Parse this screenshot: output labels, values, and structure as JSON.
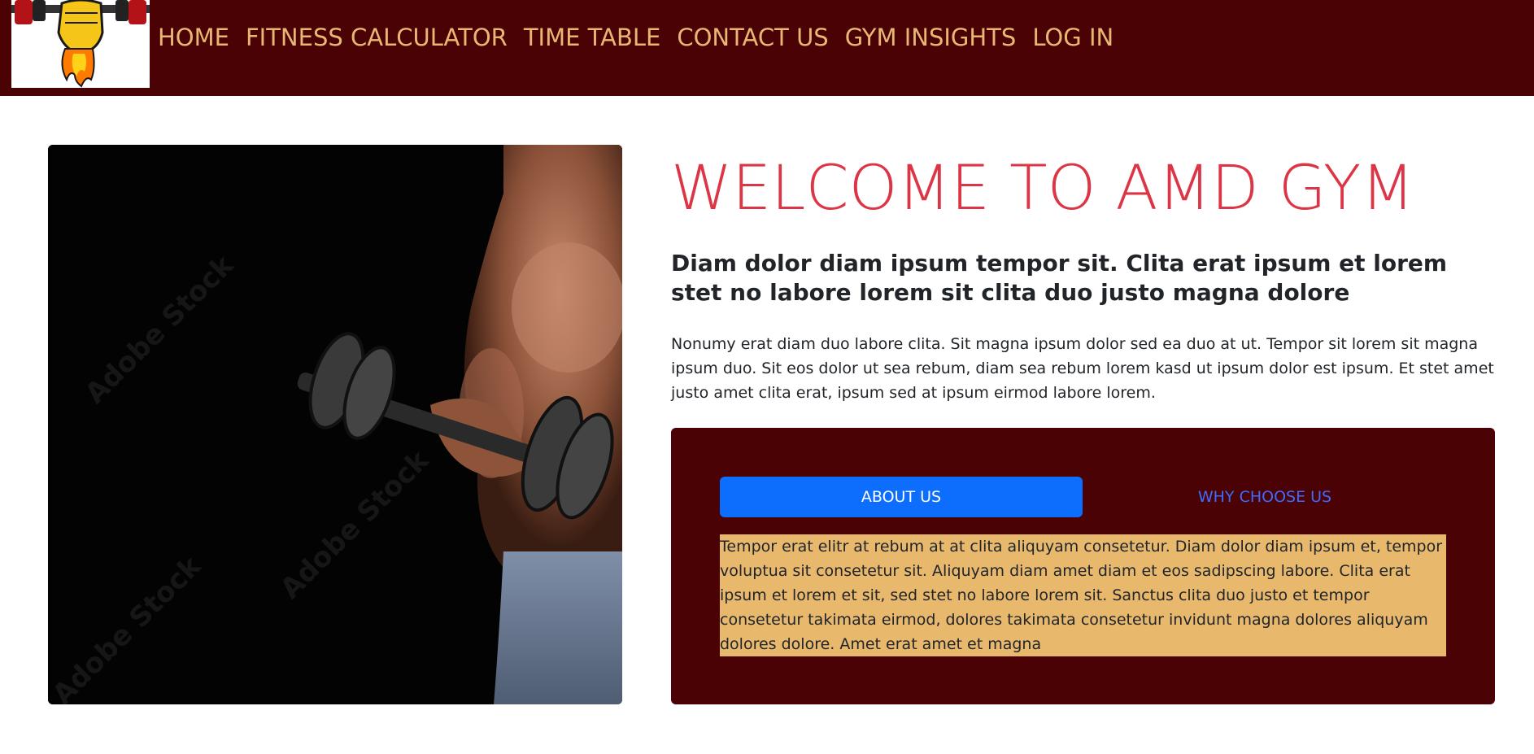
{
  "nav": {
    "items": [
      "HOME",
      "FITNESS CALCULATOR",
      "TIME TABLE",
      "CONTACT US",
      "GYM INSIGHTS",
      "LOG IN"
    ]
  },
  "hero": {
    "watermark": "Adobe Stock"
  },
  "main": {
    "title": "WELCOME TO AMD GYM",
    "subtitle": "Diam dolor diam ipsum tempor sit. Clita erat ipsum et lorem stet no labore lorem sit clita duo justo magna dolore",
    "paragraph": "Nonumy erat diam duo labore clita. Sit magna ipsum dolor sed ea duo at ut. Tempor sit lorem sit magna ipsum duo. Sit eos dolor ut sea rebum, diam sea rebum lorem kasd ut ipsum dolor est ipsum. Et stet amet justo amet clita erat, ipsum sed at ipsum eirmod labore lorem."
  },
  "tabs": {
    "items": [
      {
        "label": "ABOUT US",
        "active": true
      },
      {
        "label": "WHY CHOOSE US",
        "active": false
      }
    ],
    "content": "Tempor erat elitr at rebum at at clita aliquyam consetetur. Diam dolor diam ipsum et, tempor voluptua sit consetetur sit. Aliquyam diam amet diam et eos sadipscing labore. Clita erat ipsum et lorem et sit, sed stet no labore lorem sit. Sanctus clita duo justo et tempor consetetur takimata eirmod, dolores takimata consetetur invidunt magna dolores aliquyam dolores dolore. Amet erat amet et magna"
  },
  "colors": {
    "nav_bg": "#4a0205",
    "nav_text": "#e8b873",
    "title": "#dc3545",
    "tab_active": "#0d6efd",
    "tab_content_bg": "#e8b86d"
  }
}
